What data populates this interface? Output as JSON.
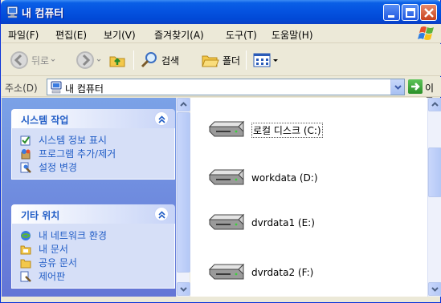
{
  "window": {
    "title": "내 컴퓨터"
  },
  "menubar": {
    "items": [
      "파일(F)",
      "편집(E)",
      "보기(V)",
      "즐겨찾기(A)",
      "도구(T)",
      "도움말(H)"
    ]
  },
  "toolbar": {
    "back_label": "뒤로",
    "search_label": "검색",
    "folders_label": "폴더"
  },
  "address": {
    "label": "주소(D)",
    "value": "내 컴퓨터",
    "go_label": "이동"
  },
  "tasks": {
    "system_tasks": {
      "title": "시스템 작업",
      "links": [
        "시스템 정보 표시",
        "프로그램 추가/제거",
        "설정 변경"
      ]
    },
    "other_places": {
      "title": "기타 위치",
      "links": [
        "내 네트워크 환경",
        "내 문서",
        "공유 문서",
        "제어판"
      ]
    }
  },
  "drives": [
    {
      "label": "로컬 디스크 (C:)",
      "selected": true
    },
    {
      "label": "workdata (D:)",
      "selected": false
    },
    {
      "label": "dvrdata1 (E:)",
      "selected": false
    },
    {
      "label": "dvrdata2 (F:)",
      "selected": false
    }
  ],
  "colors": {
    "titlebar": "#0553e0",
    "task_pane": "#7ba2e7",
    "task_link": "#215dc6"
  }
}
